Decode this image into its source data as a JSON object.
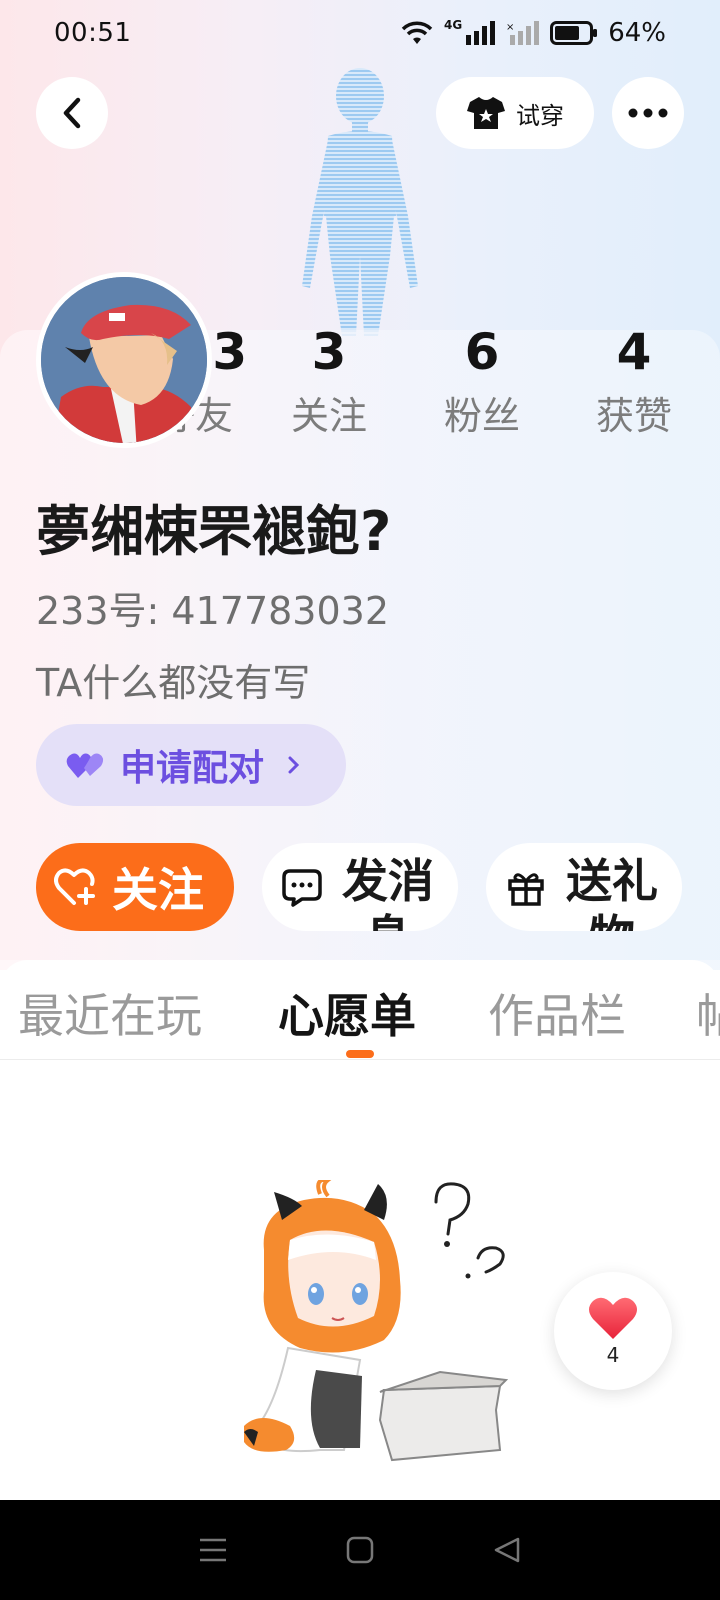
{
  "status_bar": {
    "time": "00:51",
    "network": "4G",
    "battery": "64%"
  },
  "header": {
    "try_on_label": "试穿"
  },
  "stats": [
    {
      "value": "493",
      "label": "好友"
    },
    {
      "value": "3",
      "label": "关注"
    },
    {
      "value": "6",
      "label": "粉丝"
    },
    {
      "value": "4",
      "label": "获赞"
    }
  ],
  "profile": {
    "nickname": "夢缃梀罘褪鉋?",
    "id_label": "233号: 417783032",
    "bio": "TA什么都没有写",
    "pair_label": "申请配对"
  },
  "actions": {
    "follow_label": "关注",
    "message_label": "发消息",
    "gift_label": "送礼物"
  },
  "tabs": [
    "最近在玩",
    "心愿单",
    "作品栏",
    "帖"
  ],
  "active_tab": "心愿单",
  "like": {
    "count": "4"
  },
  "colors": {
    "accent_orange": "#fc6d1a",
    "pair_purple": "#6c4fe0",
    "pair_bg": "#e4e0f8",
    "heart_red": "#f0384a"
  },
  "icons": {
    "back": "chevron-left-icon",
    "try_on": "tshirt-icon",
    "more": "more-dots-icon",
    "pair": "double-heart-icon",
    "follow": "heart-plus-icon",
    "message": "chat-bubble-icon",
    "gift": "gift-icon",
    "like": "heart-icon"
  }
}
